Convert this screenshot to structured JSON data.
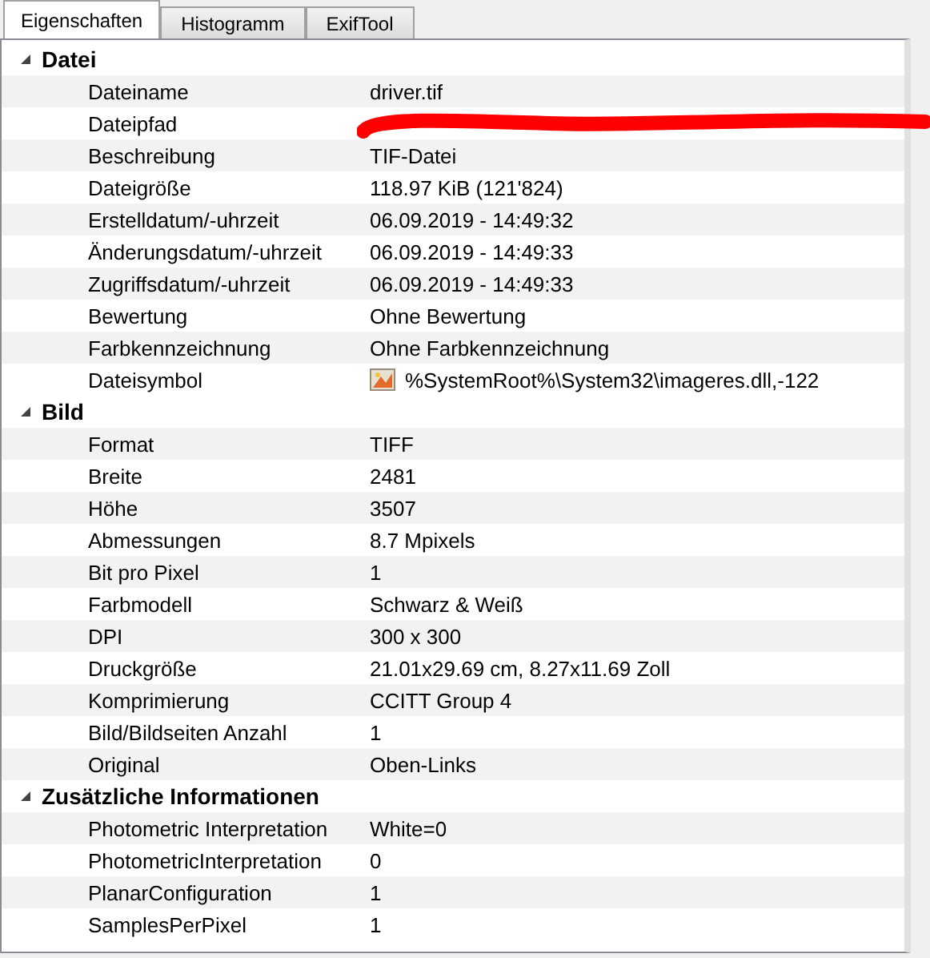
{
  "tabs": [
    {
      "label": "Eigenschaften",
      "selected": true
    },
    {
      "label": "Histogramm",
      "selected": false
    },
    {
      "label": "ExifTool",
      "selected": false
    }
  ],
  "groups": [
    {
      "title": "Datei",
      "expanded": true,
      "rows": [
        {
          "kind": "text",
          "name": "Dateiname",
          "value": "driver.tif"
        },
        {
          "kind": "redacted",
          "name": "Dateipfad"
        },
        {
          "kind": "text",
          "name": "Beschreibung",
          "value": "TIF-Datei"
        },
        {
          "kind": "text",
          "name": "Dateigröße",
          "value": "118.97 KiB (121'824)"
        },
        {
          "kind": "text",
          "name": "Erstelldatum/-uhrzeit",
          "value": "06.09.2019 - 14:49:32"
        },
        {
          "kind": "text",
          "name": "Änderungsdatum/-uhrzeit",
          "value": "06.09.2019 - 14:49:33"
        },
        {
          "kind": "text",
          "name": "Zugriffsdatum/-uhrzeit",
          "value": "06.09.2019 - 14:49:33"
        },
        {
          "kind": "text",
          "name": "Bewertung",
          "value": "Ohne Bewertung"
        },
        {
          "kind": "text",
          "name": "Farbkennzeichnung",
          "value": "Ohne Farbkennzeichnung"
        },
        {
          "kind": "icon",
          "name": "Dateisymbol",
          "value": "%SystemRoot%\\System32\\imageres.dll,-122"
        }
      ]
    },
    {
      "title": "Bild",
      "expanded": true,
      "rows": [
        {
          "kind": "text",
          "name": "Format",
          "value": "TIFF"
        },
        {
          "kind": "text",
          "name": "Breite",
          "value": "2481"
        },
        {
          "kind": "text",
          "name": "Höhe",
          "value": "3507"
        },
        {
          "kind": "text",
          "name": "Abmessungen",
          "value": "8.7 Mpixels"
        },
        {
          "kind": "text",
          "name": "Bit pro Pixel",
          "value": "1"
        },
        {
          "kind": "text",
          "name": "Farbmodell",
          "value": "Schwarz & Weiß"
        },
        {
          "kind": "text",
          "name": "DPI",
          "value": "300 x 300"
        },
        {
          "kind": "text",
          "name": "Druckgröße",
          "value": "21.01x29.69 cm, 8.27x11.69 Zoll"
        },
        {
          "kind": "text",
          "name": "Komprimierung",
          "value": "CCITT Group 4"
        },
        {
          "kind": "text",
          "name": "Bild/Bildseiten Anzahl",
          "value": "1"
        },
        {
          "kind": "text",
          "name": "Original",
          "value": "Oben-Links"
        }
      ]
    },
    {
      "title": "Zusätzliche Informationen",
      "expanded": true,
      "rows": [
        {
          "kind": "text",
          "name": "Photometric Interpretation",
          "value": "White=0"
        },
        {
          "kind": "text",
          "name": "PhotometricInterpretation",
          "value": "0"
        },
        {
          "kind": "text",
          "name": "PlanarConfiguration",
          "value": "1"
        },
        {
          "kind": "text",
          "name": "SamplesPerPixel",
          "value": "1"
        }
      ]
    }
  ]
}
